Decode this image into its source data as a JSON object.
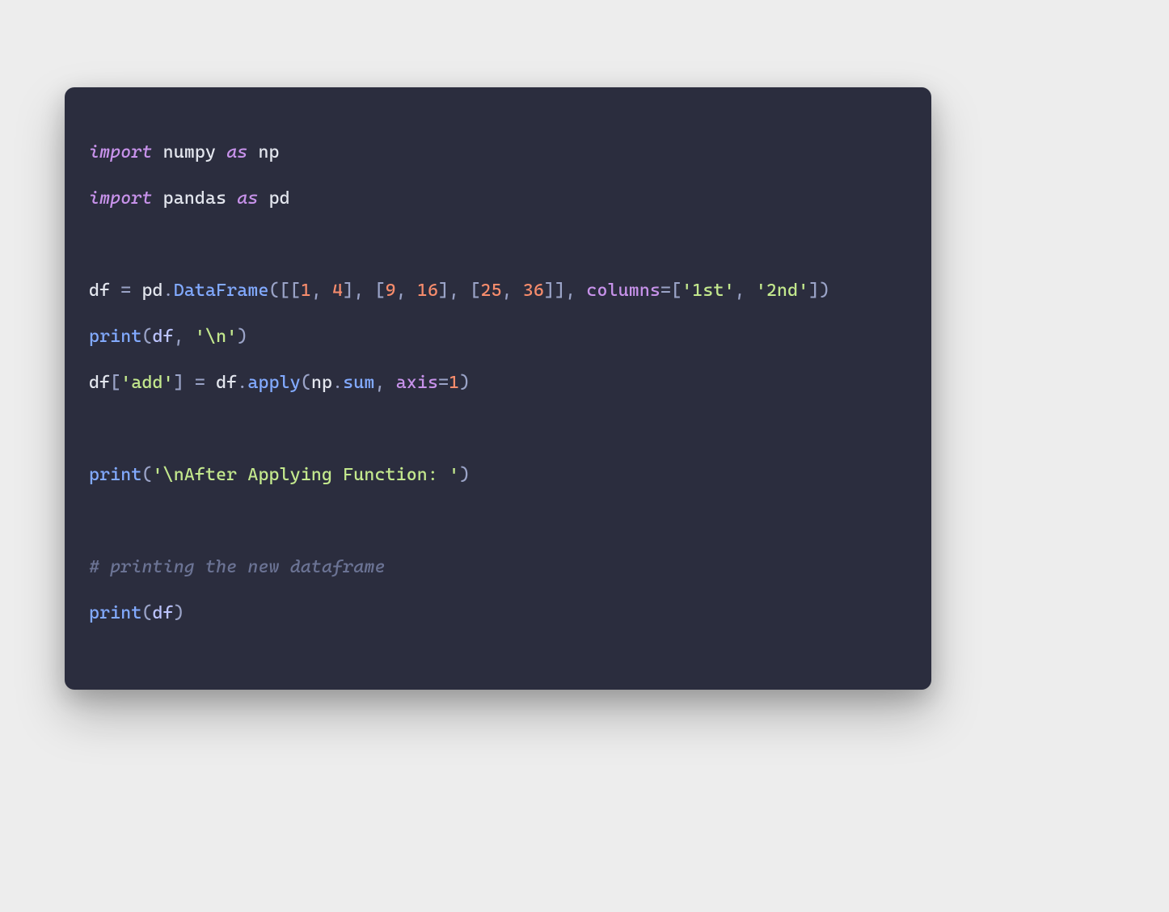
{
  "code": {
    "l1": {
      "import": "import",
      "mod": "numpy",
      "as": "as",
      "alias": "np"
    },
    "l2": {
      "import": "import",
      "mod": "pandas",
      "as": "as",
      "alias": "pd"
    },
    "l3": {
      "lhs": "df",
      "eq": " = ",
      "pd": "pd",
      "dot": ".",
      "fn": "DataFrame",
      "open": "([[",
      "n1": "1",
      "c1": ", ",
      "n2": "4",
      "r1": "], [",
      "n3": "9",
      "c2": ", ",
      "n4": "16",
      "r2": "], [",
      "n5": "25",
      "c3": ", ",
      "n6": "36",
      "close_rows": "]], ",
      "kw_columns": "columns",
      "eq2": "=",
      "open_cols": "[",
      "s1": "'1st'",
      "cc": ", ",
      "s2": "'2nd'",
      "close_cols": "])"
    },
    "l4": {
      "fn": "print",
      "open": "(",
      "arg": "df",
      "comma": ", ",
      "str": "'\\n'",
      "close": ")"
    },
    "l5": {
      "lhs": "df",
      "idx_open": "[",
      "key": "'add'",
      "idx_close": "]",
      "eq": " = ",
      "rhs_obj": "df",
      "dot": ".",
      "apply": "apply",
      "open": "(",
      "np": "np",
      "dot2": ".",
      "sum": "sum",
      "comma": ", ",
      "axis_kw": "axis",
      "eq2": "=",
      "axis_val": "1",
      "close": ")"
    },
    "l6": {
      "fn": "print",
      "open": "(",
      "str": "'\\nAfter Applying Function: '",
      "close": ")"
    },
    "l7": {
      "comment": "# printing the new dataframe"
    },
    "l8": {
      "fn": "print",
      "open": "(",
      "arg": "df",
      "close": ")"
    }
  }
}
